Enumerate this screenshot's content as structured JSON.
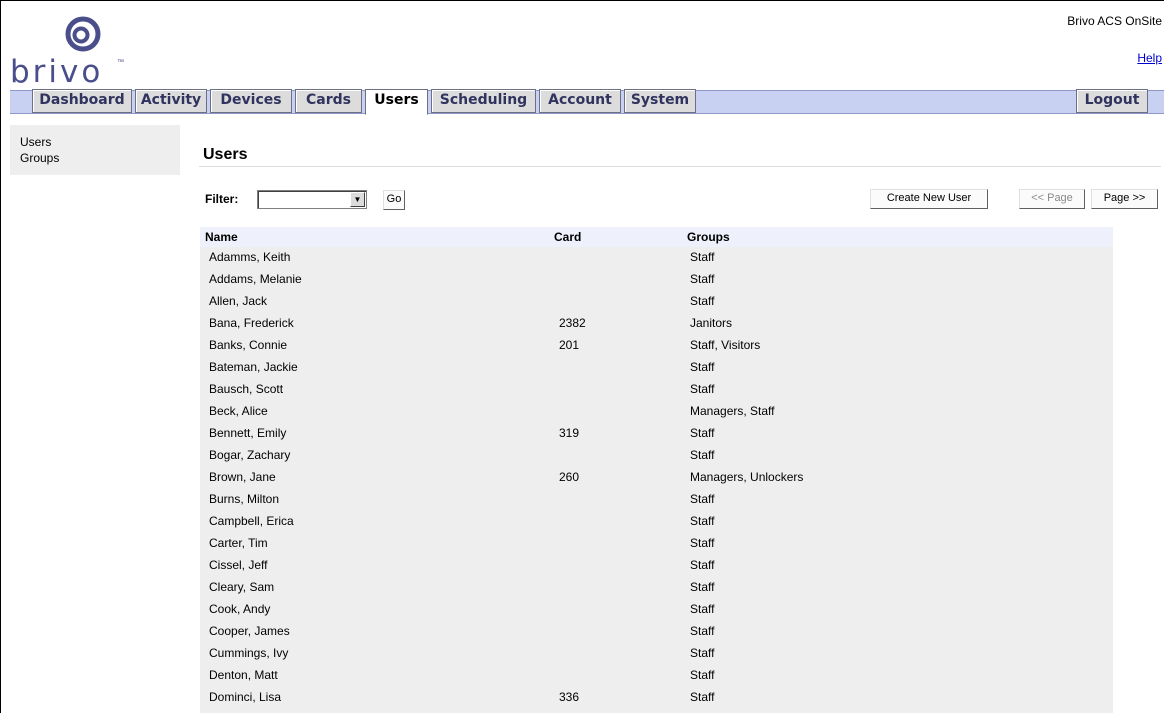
{
  "header": {
    "logo_text": "brivo",
    "logo_tm": "™",
    "site_name": "Brivo ACS OnSite",
    "help_label": "Help"
  },
  "nav": {
    "tabs": [
      "Dashboard",
      "Activity",
      "Devices",
      "Cards",
      "Users",
      "Scheduling",
      "Account",
      "System"
    ],
    "active_tab": "Users",
    "logout_label": "Logout"
  },
  "sidebar": {
    "items": [
      "Users",
      "Groups"
    ]
  },
  "main": {
    "title": "Users",
    "filter": {
      "label": "Filter:",
      "selected_value": "",
      "go_label": "Go"
    },
    "create_button": "Create New User",
    "prev_page_button": "<< Page",
    "next_page_button": "Page >>",
    "table": {
      "columns": [
        "Name",
        "Card",
        "Groups"
      ],
      "rows": [
        [
          "Adamms, Keith",
          "",
          "Staff"
        ],
        [
          "Addams, Melanie",
          "",
          "Staff"
        ],
        [
          "Allen, Jack",
          "",
          "Staff"
        ],
        [
          "Bana, Frederick",
          "2382",
          "Janitors"
        ],
        [
          "Banks, Connie",
          "201",
          "Staff, Visitors"
        ],
        [
          "Bateman, Jackie",
          "",
          "Staff"
        ],
        [
          "Bausch, Scott",
          "",
          "Staff"
        ],
        [
          "Beck, Alice",
          "",
          "Managers, Staff"
        ],
        [
          "Bennett, Emily",
          "319",
          "Staff"
        ],
        [
          "Bogar, Zachary",
          "",
          "Staff"
        ],
        [
          "Brown, Jane",
          "260",
          "Managers, Unlockers"
        ],
        [
          "Burns, Milton",
          "",
          "Staff"
        ],
        [
          "Campbell, Erica",
          "",
          "Staff"
        ],
        [
          "Carter, Tim",
          "",
          "Staff"
        ],
        [
          "Cissel, Jeff",
          "",
          "Staff"
        ],
        [
          "Cleary, Sam",
          "",
          "Staff"
        ],
        [
          "Cook, Andy",
          "",
          "Staff"
        ],
        [
          "Cooper, James",
          "",
          "Staff"
        ],
        [
          "Cummings, Ivy",
          "",
          "Staff"
        ],
        [
          "Denton, Matt",
          "",
          "Staff"
        ],
        [
          "Dominci, Lisa",
          "336",
          "Staff"
        ]
      ]
    }
  },
  "colors": {
    "nav_bar": "#c9d1f2",
    "tab_text": "#30335e",
    "logo": "#4a4e8a",
    "link": "#0000cc",
    "table_body": "#eeeeee",
    "table_header": "#eef0fc"
  }
}
